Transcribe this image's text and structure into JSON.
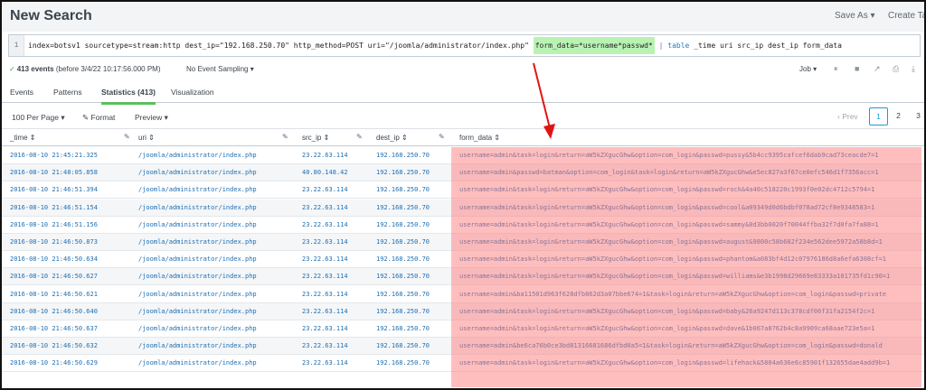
{
  "header": {
    "title": "New Search",
    "save_as": "Save As ▾",
    "create_table": "Create Tab"
  },
  "search": {
    "line_number": "1",
    "query_prefix": "index=botsv1 sourcetype=stream:http dest_ip=\"192.168.250.70\" http_method=POST uri=\"/joomla/administrator/index.php\"",
    "query_highlight": "form_data=*username*passwd*",
    "query_pipe": "|",
    "query_command": "table",
    "query_suffix": "_time uri src_ip dest_ip form_data"
  },
  "status": {
    "check": "✓",
    "count": "413 events",
    "range": "(before 3/4/22 10:17:56.000 PM)",
    "sampling": "No Event Sampling ▾",
    "job": "Job ▾"
  },
  "controls": {
    "pause": "⏸",
    "stop": "■",
    "share": "↗",
    "print": "⎙",
    "export": "⤓"
  },
  "tabs": [
    {
      "label": "Events",
      "active": false
    },
    {
      "label": "Patterns",
      "active": false
    },
    {
      "label": "Statistics (413)",
      "active": true
    },
    {
      "label": "Visualization",
      "active": false
    }
  ],
  "toolbar": {
    "per_page": "100 Per Page ▾",
    "format": "Format",
    "format_icon": "✎",
    "preview": "Preview ▾"
  },
  "pagination": {
    "prev": "‹ Prev",
    "pages": [
      "1",
      "2",
      "3"
    ],
    "current": "1"
  },
  "columns": [
    "_time ⇕",
    "uri ⇕",
    "src_ip ⇕",
    "dest_ip ⇕",
    "form_data ⇕"
  ],
  "column_edit_icon": "✎",
  "rows": [
    [
      "2016-08-10 21:45:21.325",
      "/joomla/administrator/index.php",
      "23.22.63.114",
      "192.168.250.70",
      "username=admin&task=login&return=aW5kZXgucGhw&option=com_login&passwd=pussy&5b4cc9395cafcef6dab9cad73ceacde7=1"
    ],
    [
      "2016-08-10 21:48:05.858",
      "/joomla/administrator/index.php",
      "40.80.148.42",
      "192.168.250.70",
      "username=admin&passwd=batman&option=com_login&task=login&return=aW5kZXgucGhw&e5ec827a3f67ce0efc546d1f7356acc=1"
    ],
    [
      "2016-08-10 21:46:51.394",
      "/joomla/administrator/index.php",
      "23.22.63.114",
      "192.168.250.70",
      "username=admin&task=login&return=aW5kZXgucGhw&option=com_login&passwd=rock&4a40c518220c1993f0e02dc4712c5794=1"
    ],
    [
      "2016-08-10 21:46:51.154",
      "/joomla/administrator/index.php",
      "23.22.63.114",
      "192.168.250.70",
      "username=admin&task=login&return=aW5kZXgucGhw&option=com_login&passwd=cool&a09349d0d6bdbf078ad72cf8e9348583=1"
    ],
    [
      "2016-08-10 21:46:51.156",
      "/joomla/administrator/index.php",
      "23.22.63.114",
      "192.168.250.70",
      "username=admin&task=login&return=aW5kZXgucGhw&option=com_login&passwd=sammy&0d3bb0020f70044ffba32f7d0fa7fa88=1"
    ],
    [
      "2016-08-10 21:46:50.873",
      "/joomla/administrator/index.php",
      "23.22.63.114",
      "192.168.250.70",
      "username=admin&task=login&return=aW5kZXgucGhw&option=com_login&passwd=august&9800c58b682f234e562dee5972a58b8d=1"
    ],
    [
      "2016-08-10 21:46:50.634",
      "/joomla/administrator/index.php",
      "23.22.63.114",
      "192.168.250.70",
      "username=admin&task=login&return=aW5kZXgucGhw&option=com_login&passwd=phantom&a083bf4d12c07976186d8a6efa6308cf=1"
    ],
    [
      "2016-08-10 21:46:50.627",
      "/joomla/administrator/index.php",
      "23.22.63.114",
      "192.168.250.70",
      "username=admin&task=login&return=aW5kZXgucGhw&option=com_login&passwd=williams&e3b1998d29669e83333a101735fd1c90=1"
    ],
    [
      "2016-08-10 21:46:50.621",
      "/joomla/administrator/index.php",
      "23.22.63.114",
      "192.168.250.70",
      "username=admin&ba11501d963f628dfb862d3a07bbe674=1&task=login&return=aW5kZXgucGhw&option=com_login&passwd=private"
    ],
    [
      "2016-08-10 21:46:50.640",
      "/joomla/administrator/index.php",
      "23.22.63.114",
      "192.168.250.70",
      "username=admin&task=login&return=aW5kZXgucGhw&option=com_login&passwd=baby&26a9247d113c378cdf06f31fa2154f2c=1"
    ],
    [
      "2016-08-10 21:46:50.637",
      "/joomla/administrator/index.php",
      "23.22.63.114",
      "192.168.250.70",
      "username=admin&task=login&return=aW5kZXgucGhw&option=com_login&passwd=dave&1b067a8762b4c8a9909ca68aae723e5a=1"
    ],
    [
      "2016-08-10 21:46:50.632",
      "/joomla/administrator/index.php",
      "23.22.63.114",
      "192.168.250.70",
      "username=admin&be6ca76b0ce3bd81316681686dfbd0a5=1&task=login&return=aW5kZXgucGhw&option=com_login&passwd=donald"
    ],
    [
      "2016-08-10 21:46:50.629",
      "/joomla/administrator/index.php",
      "23.22.63.114",
      "192.168.250.70",
      "username=admin&task=login&return=aW5kZXgucGhw&option=com_login&passwd=lifehack&5804a636e6c85901f132655dae4add9b=1"
    ]
  ],
  "colors": {
    "highlight": "#b9f3b4",
    "annotation_box": "#ff7878",
    "annotation_arrow": "#e11414",
    "link": "#1e6fb3"
  }
}
